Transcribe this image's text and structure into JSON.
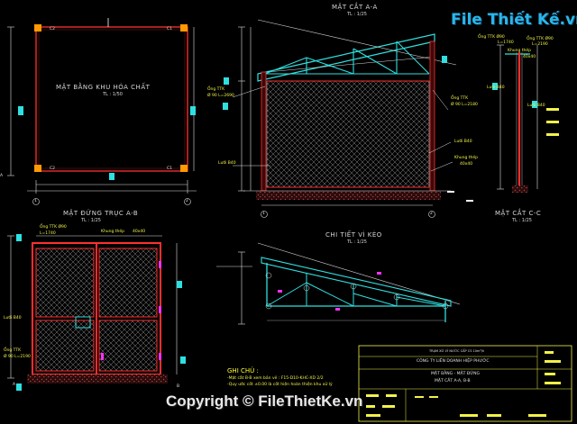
{
  "plan": {
    "title": "MẶT BẰNG KHU HÓA CHẤT",
    "scale": "TL : 1/50",
    "c1": "C1",
    "c2": "C2"
  },
  "section_aa": {
    "title": "MẶT CẮT A-A",
    "scale": "TL : 1/25",
    "tag_pipe": "Ống TTK",
    "tag_pipe_dim": "Ø 90 L=2690",
    "tag_pipe2": "Ống TTK",
    "tag_pipe2_dim": "Ø 90 L=2180",
    "tag_mesh": "Lưới B40",
    "tag_frame": "Khung thép",
    "tag_frame_dim": "40x40",
    "tag_mesh_left": "Lưới B40"
  },
  "section_cc": {
    "title": "MẶT CẮT C-C",
    "scale": "TL : 1/25",
    "tag_pipe": "Ống TTK Ø90",
    "tag_pipe_dim": "L=1740",
    "tag_pipe2": "Ống TTK Ø90",
    "tag_pipe2_dim": "L=2190",
    "tag_frame": "Khung thép",
    "tag_frame_dim": "40x40",
    "tag_mesh": "Lưới B40",
    "tag_mesh2": "Lưới B40"
  },
  "elevation": {
    "title": "MẶT ĐỨNG TRỤC A-B",
    "scale": "TL : 1/25",
    "tag_pipe": "Ống TTK Ø90",
    "tag_pipe_dim": "L=1740",
    "tag_frame": "Khung thép",
    "tag_frame_dim": "40x40",
    "tag_mesh": "Lưới B40",
    "tag_pipe2": "Ống TTK",
    "tag_pipe2_dim": "Ø 90 L=2190"
  },
  "truss": {
    "title": "CHI TIẾT VÌ KÈO",
    "scale": "TL : 1/25"
  },
  "notes": {
    "title": "GHI CHÚ :",
    "line1": "-Mặt cắt B-B xem bản vẽ : F15-D10-KHC-XD 2/2",
    "line2": "-Quy ước cốt ±0.00 là cốt hiện hoàn thiện khu xử lý"
  },
  "title_block": {
    "project": "TRẠM XỬ LÝ NƯỚC CẤP CS 10m³/h",
    "company": "CÔNG TY LIÊN DOANH HIỆP PHƯỚC",
    "sheet1": "MẶT BẰNG - MẶT ĐỨNG",
    "sheet2": "MẶT CẮT A-A, B-B"
  },
  "axes": {
    "a": "A",
    "b": "B",
    "one": "1",
    "two": "2"
  },
  "watermark": {
    "logo": "File Thiết Kế.vn",
    "copyright": "Copyright © FileThietKe.vn"
  },
  "colors": {
    "frame": "#ff2b2b",
    "mesh": "#9a9a9a",
    "pipe": "#2fe0e0",
    "dim": "#e8e8e8",
    "text": "#f2f24a",
    "ground": "#a03030"
  }
}
